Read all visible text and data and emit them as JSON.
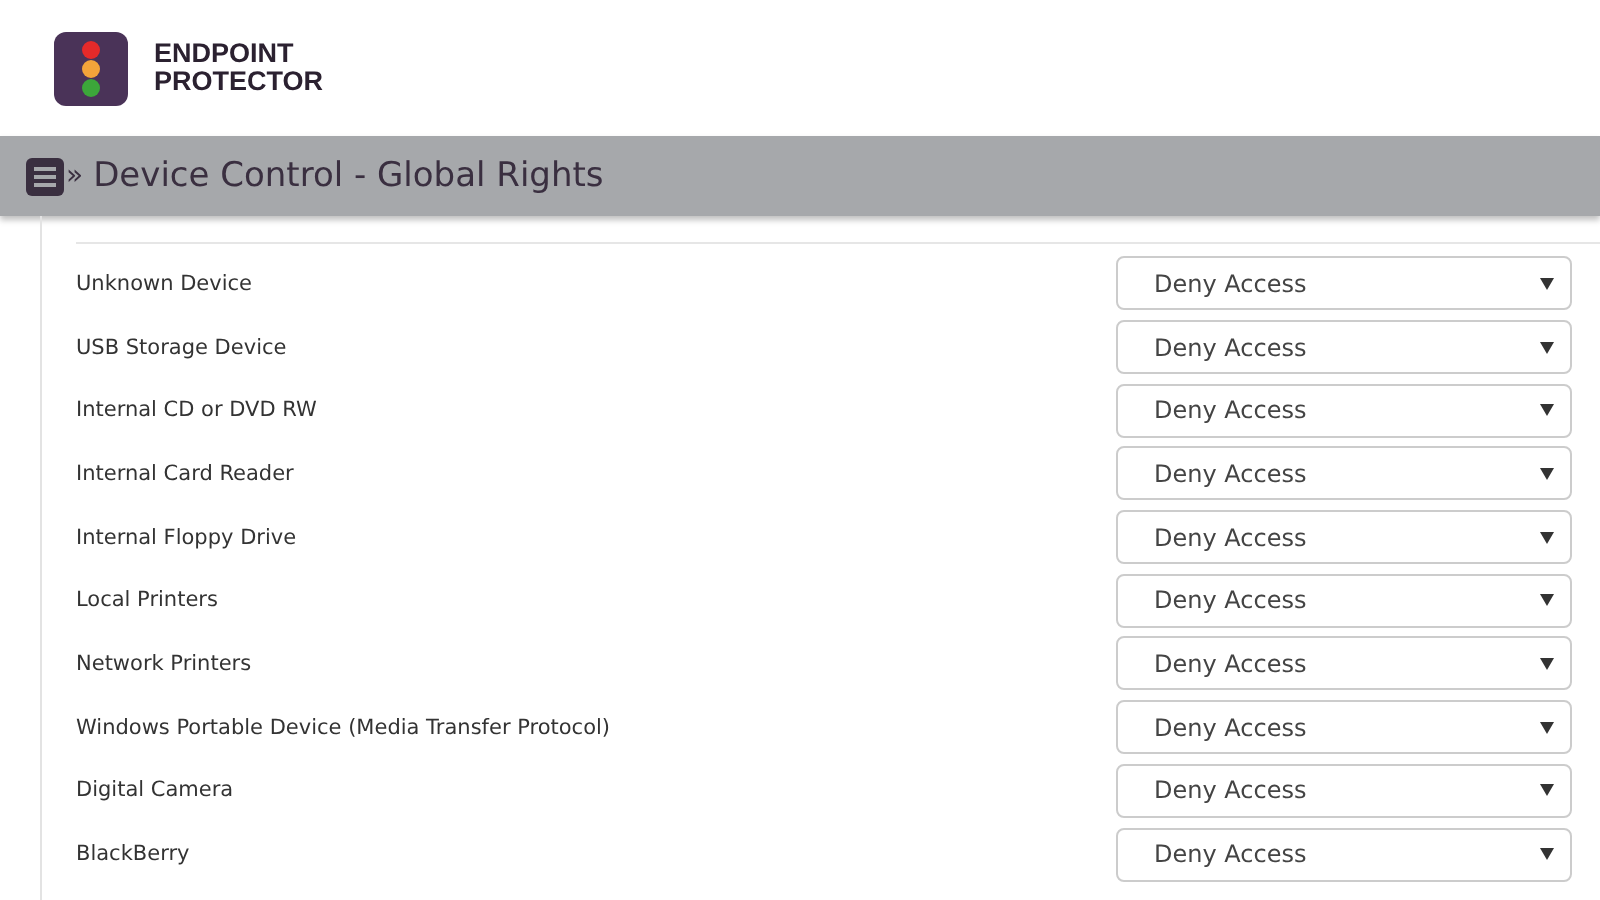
{
  "logo": {
    "line_1": "ENDPOINT",
    "line_2": "PROTECTOR"
  },
  "header": {
    "separator": "»",
    "title": "Device Control - Global Rights"
  },
  "devices": [
    {
      "name": "Unknown Device",
      "access": "Deny Access"
    },
    {
      "name": "USB Storage Device",
      "access": "Deny Access"
    },
    {
      "name": "Internal CD or DVD RW",
      "access": "Deny Access"
    },
    {
      "name": "Internal Card Reader",
      "access": "Deny Access"
    },
    {
      "name": "Internal Floppy Drive",
      "access": "Deny Access"
    },
    {
      "name": "Local Printers",
      "access": "Deny Access"
    },
    {
      "name": "Network Printers",
      "access": "Deny Access"
    },
    {
      "name": "Windows Portable Device (Media Transfer Protocol)",
      "access": "Deny Access"
    },
    {
      "name": "Digital Camera",
      "access": "Deny Access"
    },
    {
      "name": "BlackBerry",
      "access": "Deny Access"
    }
  ]
}
